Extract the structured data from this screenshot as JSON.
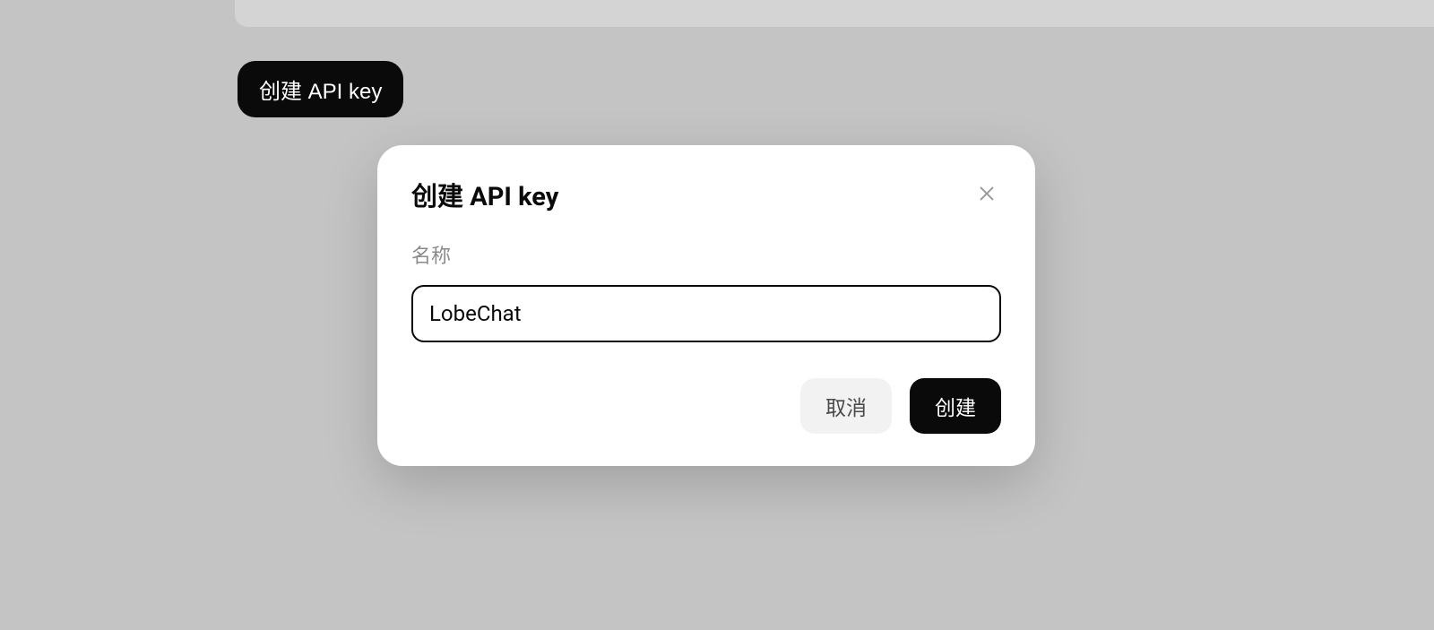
{
  "page": {
    "create_button_label": "创建 API key"
  },
  "modal": {
    "title": "创建 API key",
    "name_label": "名称",
    "name_value": "LobeChat",
    "cancel_label": "取消",
    "confirm_label": "创建"
  }
}
